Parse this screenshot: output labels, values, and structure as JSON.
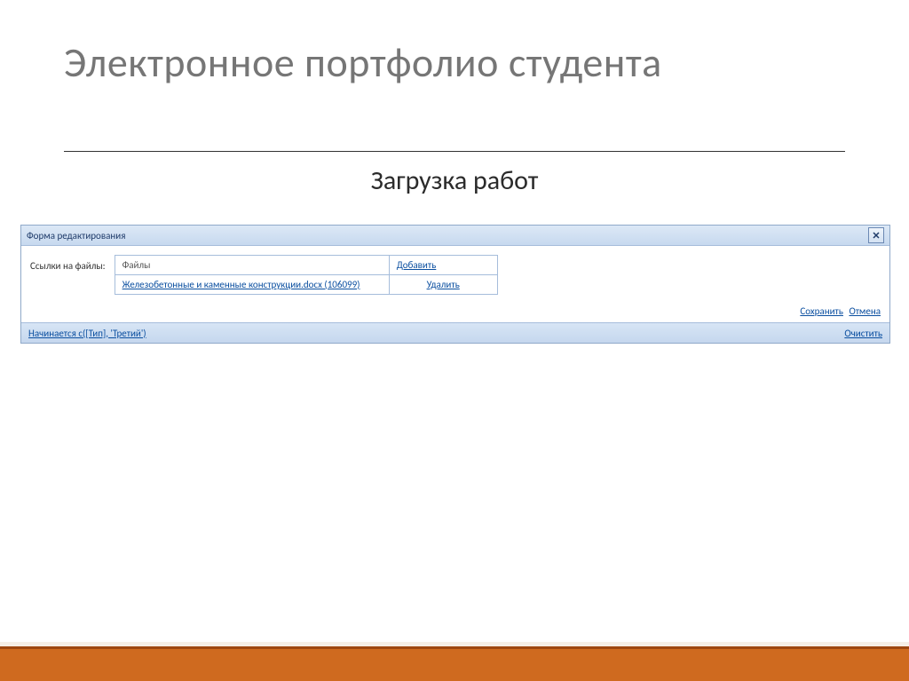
{
  "title": "Электронное портфолио студента",
  "subtitle": "Загрузка работ",
  "panel": {
    "header": "Форма редактирования",
    "close_glyph": "✕",
    "files_label": "Ссылки на файлы:",
    "col_files": "Файлы",
    "add": "Добавить",
    "file_link": "Железобетонные и каменные конструкции.docx (106099)",
    "delete": "Удалить",
    "save": "Сохранить",
    "cancel": "Отмена",
    "footer_left": "Начинается с([Тип], 'Третий')",
    "footer_clear": "Очистить"
  }
}
